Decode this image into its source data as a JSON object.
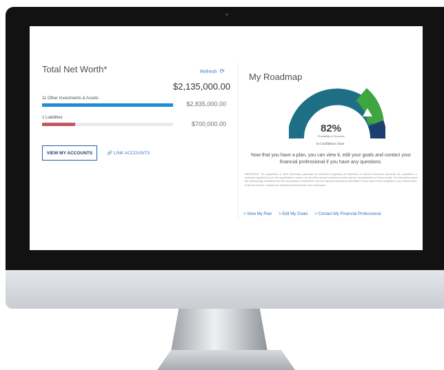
{
  "net_worth": {
    "title": "Total Net Worth*",
    "refresh_label": "Refresh",
    "total": "$2,135,000.00",
    "rows": [
      {
        "label": "11 Other Investments & Assets",
        "value": "$2,835,000.00",
        "fill_fraction": 1.0,
        "color": "#1f8ed6"
      },
      {
        "label": "1 Liabilities",
        "value": "$700,000.00",
        "fill_fraction": 0.25,
        "color": "#c25a66"
      }
    ],
    "view_accounts_label": "VIEW MY ACCOUNTS",
    "link_accounts_label": "LINK ACCOUNTS"
  },
  "roadmap": {
    "title": "My Roadmap",
    "probability": "82%",
    "probability_label": "Probability of Success",
    "zone_label": "In Confidence Zone",
    "message": "Now that you have a plan, you can view it, edit your goals and contact your financial professional if you have any questions.",
    "important": "IMPORTANT: The projections or other information generated by AdvisorFlo regarding the likelihood of various investment outcomes are predictions or estimates supplied by you, are hypothetical in nature, do not reflect actual investment results and are not guarantees of future results. For information about the methodology, limitations and key assumptions in AdvisorFlo, see the Important Disclosure information in your report that is available in your Shared folder in My Documents. Consult your financial professional for more information.",
    "links": [
      "> View My Plan",
      "> Edit My Goals",
      "> Contact My Financial Professional"
    ],
    "colors": {
      "dark": "#1b3f6e",
      "teal": "#1e6f86",
      "green": "#3ea540"
    }
  }
}
